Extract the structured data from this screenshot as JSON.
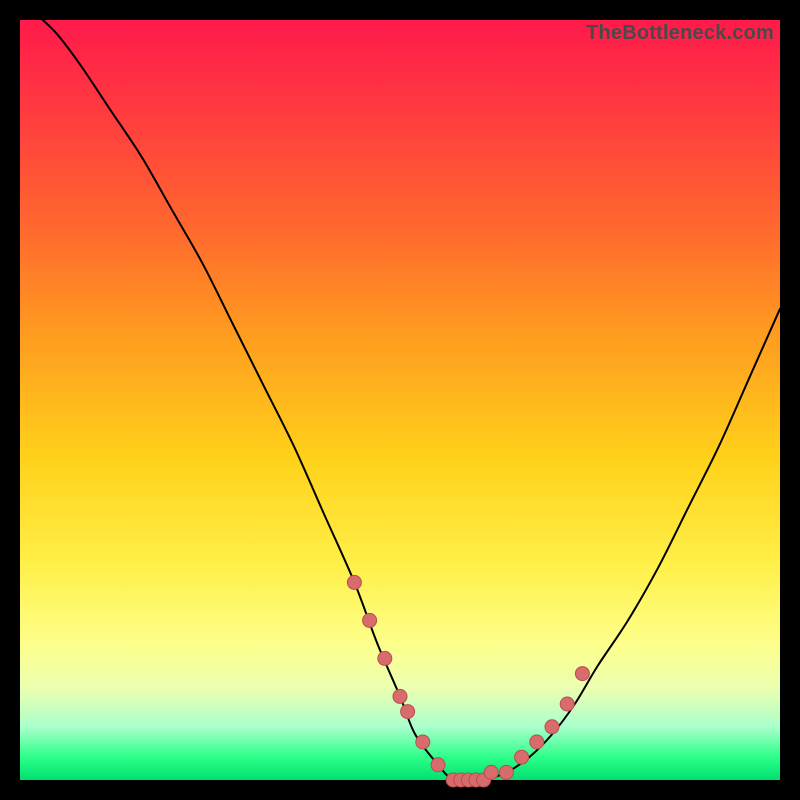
{
  "watermark": "TheBottleneck.com",
  "chart_data": {
    "type": "line",
    "title": "",
    "xlabel": "",
    "ylabel": "",
    "xlim": [
      0,
      100
    ],
    "ylim": [
      0,
      100
    ],
    "grid": false,
    "background_gradient": [
      "#ff1a4b",
      "#ff6a2d",
      "#ffd21a",
      "#fdff8a",
      "#2cff88"
    ],
    "series": [
      {
        "name": "bottleneck-curve",
        "x": [
          3,
          5,
          8,
          12,
          16,
          20,
          24,
          28,
          32,
          36,
          40,
          44,
          47,
          50,
          52,
          55,
          57,
          59,
          61,
          64,
          67,
          70,
          73,
          76,
          80,
          84,
          88,
          92,
          96,
          100
        ],
        "y": [
          100,
          98,
          94,
          88,
          82,
          75,
          68,
          60,
          52,
          44,
          35,
          26,
          18,
          11,
          6,
          2,
          0,
          0,
          0,
          1,
          3,
          6,
          10,
          15,
          21,
          28,
          36,
          44,
          53,
          62
        ],
        "color": "#000000"
      }
    ],
    "markers": [
      {
        "name": "highlight-dots",
        "x": [
          44,
          46,
          48,
          50,
          51,
          53,
          55,
          57,
          58,
          59,
          60,
          61,
          62,
          64,
          66,
          68,
          70,
          72,
          74
        ],
        "y": [
          26,
          21,
          16,
          11,
          9,
          5,
          2,
          0,
          0,
          0,
          0,
          0,
          1,
          1,
          3,
          5,
          7,
          10,
          14
        ],
        "color": "#d86b6b",
        "radius": 7
      }
    ]
  }
}
